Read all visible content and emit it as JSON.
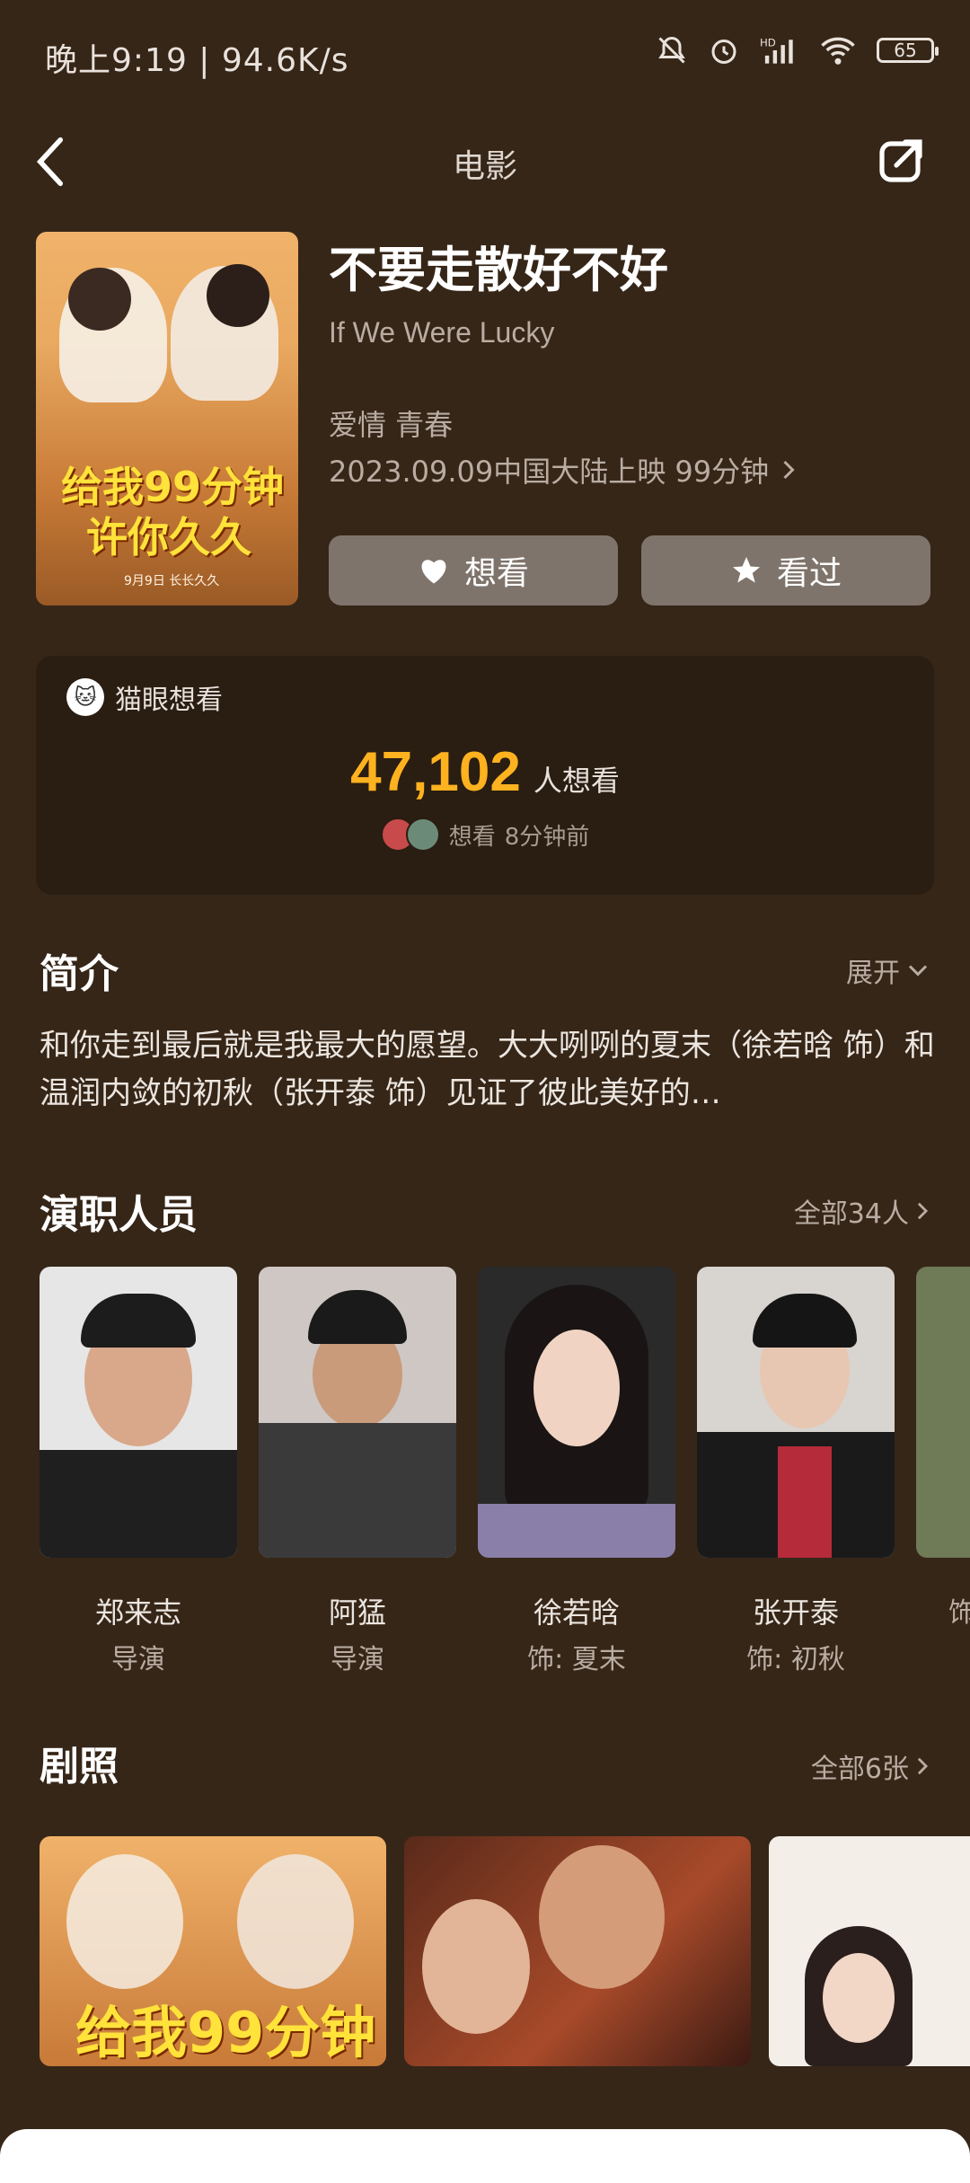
{
  "status_bar": {
    "time_speed": "晚上9:19 | 94.6K/s",
    "battery": "65",
    "icons": [
      "bell-off-icon",
      "alarm-icon",
      "hd-signal-icon",
      "wifi-icon",
      "battery-icon"
    ]
  },
  "header": {
    "title": "电影",
    "back_icon": "chevron-left-icon",
    "share_icon": "share-icon"
  },
  "movie": {
    "poster_text_line1": "给我99分钟",
    "poster_text_line2": "许你久久",
    "poster_text_small": "9月9日 长长久久",
    "title": "不要走散好不好",
    "english_title": "If We Were Lucky",
    "genres": "爱情 青春",
    "release_info": "2023.09.09中国大陆上映 99分钟"
  },
  "actions": {
    "want_label": "想看",
    "seen_label": "看过"
  },
  "maoyan": {
    "label": "猫眼想看",
    "count": "47,102",
    "count_suffix": "人想看",
    "activity_action": "想看",
    "activity_time": "8分钟前"
  },
  "synopsis": {
    "title": "简介",
    "expand_label": "展开",
    "text": "和你走到最后就是我最大的愿望。大大咧咧的夏末（徐若晗 饰）和温润内敛的初秋（张开泰 饰）见证了彼此美好的…"
  },
  "cast": {
    "title": "演职人员",
    "all_label": "全部34人",
    "members": [
      {
        "name": "郑来志",
        "role": "导演"
      },
      {
        "name": "阿猛",
        "role": "导演"
      },
      {
        "name": "徐若晗",
        "role": "饰: 夏末"
      },
      {
        "name": "张开泰",
        "role": "饰: 初秋"
      },
      {
        "name": "",
        "role": "饰"
      }
    ]
  },
  "stills": {
    "title": "剧照",
    "all_label": "全部6张",
    "still1_text": "给我99分钟"
  },
  "colors": {
    "background": "#362618",
    "card": "#2a1d12",
    "accent_count": "#ffb21f",
    "button": "#7f746b"
  }
}
